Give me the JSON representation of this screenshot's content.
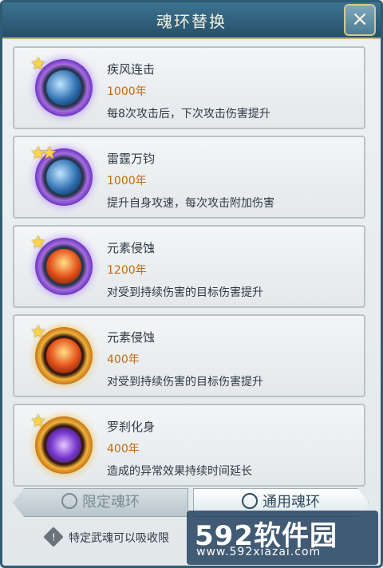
{
  "header": {
    "title": "魂环替换",
    "close_icon": "close-icon"
  },
  "rings": [
    {
      "name": "疾风连击",
      "years": "1000年",
      "desc": "每8次攻击后，下次攻击伤害提升",
      "stars": 1,
      "frame": "purple",
      "icon": "wind-slash-icon"
    },
    {
      "name": "雷霆万钧",
      "years": "1000年",
      "desc": "提升自身攻速，每次攻击附加伤害",
      "stars": 2,
      "frame": "purple",
      "icon": "thunder-warrior-icon"
    },
    {
      "name": "元素侵蚀",
      "years": "1200年",
      "desc": "对受到持续伤害的目标伤害提升",
      "stars": 1,
      "frame": "purple",
      "icon": "fire-corrosion-icon"
    },
    {
      "name": "元素侵蚀",
      "years": "400年",
      "desc": "对受到持续伤害的目标伤害提升",
      "stars": 1,
      "frame": "gold",
      "icon": "fire-corrosion-icon"
    },
    {
      "name": "罗刹化身",
      "years": "400年",
      "desc": "造成的异常效果持续时间延长",
      "stars": 1,
      "frame": "gold",
      "icon": "violet-shadow-icon"
    }
  ],
  "tabs": {
    "limited": "限定魂环",
    "general": "通用魂环"
  },
  "notice": {
    "text": "特定武魂可以吸收限"
  },
  "watermark": {
    "logo": "592软件园",
    "url": "www.592xiazai.com"
  },
  "colors": {
    "years": "#c06a12",
    "header": "#2f5b73",
    "accent": "#c9b77f"
  }
}
